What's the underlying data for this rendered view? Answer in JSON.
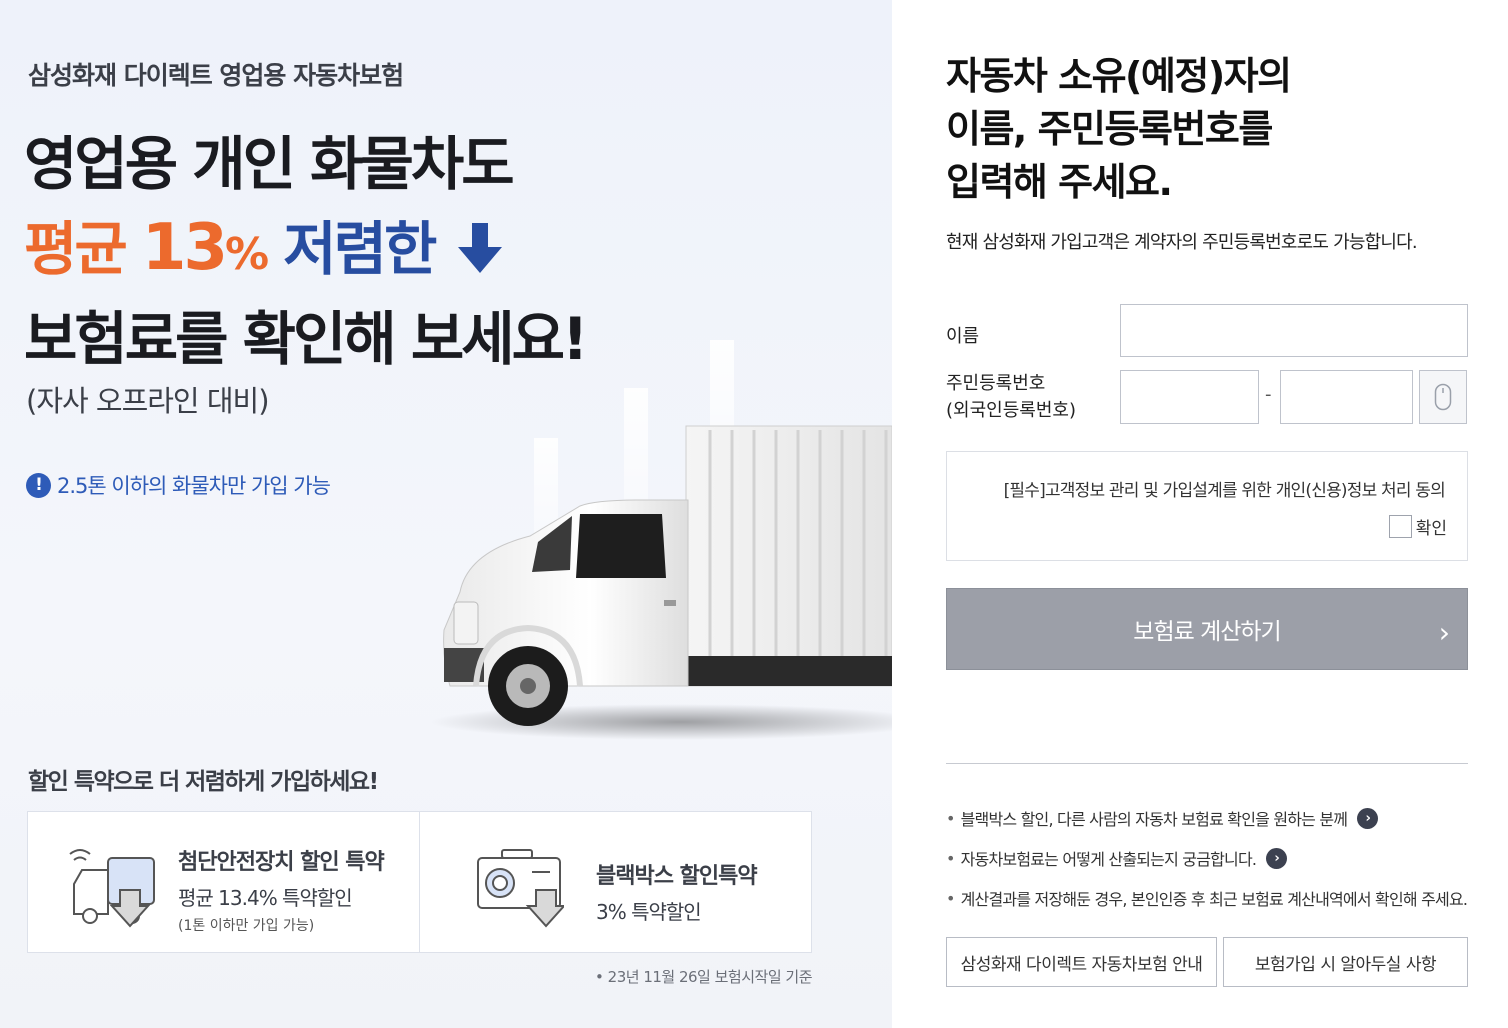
{
  "promo": {
    "brand": "삼성화재 다이렉트 영업용 자동차보험",
    "headline_line1": "영업용 개인 화물차도",
    "headline_avg": "평균 ",
    "headline_pct_number": "13",
    "headline_pct_sign": "%",
    "headline_cheaper": " 저렴한",
    "headline_line3": "보험료를 확인해 보세요!",
    "sub_note": "(자사 오프라인 대비)",
    "notice_icon": "!",
    "notice_text": "2.5톤 이하의 화물차만 가입 가능",
    "discount_title": "할인 특약으로 더 저렴하게 가입하세요!",
    "discounts": [
      {
        "icon": "truck-down-arrow-icon",
        "title": "첨단안전장치 할인 특약",
        "sub": "평균 13.4% 특약할인",
        "note": "(1톤 이하만 가입 가능)"
      },
      {
        "icon": "dashcam-down-arrow-icon",
        "title": "블랙박스 할인특약",
        "sub": "3% 특약할인",
        "note": ""
      }
    ],
    "footnote": "• 23년 11월 26일 보험시작일 기준"
  },
  "form": {
    "title": "자동차 소유(예정)자의\n이름, 주민등록번호를\n입력해 주세요.",
    "description": "현재 삼성화재 가입고객은 계약자의 주민등록번호로도 가능합니다.",
    "name_label": "이름",
    "name_value": "",
    "rrn_label_line1": "주민등록번호",
    "rrn_label_line2": "(외국인등록번호)",
    "rrn_front_value": "",
    "rrn_dash": "-",
    "rrn_back_value": "",
    "consent_text": "[필수]고객정보 관리 및 가입설계를 위한 개인(신용)정보 처리 동의",
    "consent_check_label": "확인",
    "consent_checked": false,
    "calc_button": "보험료 계산하기",
    "calc_chevron": "›"
  },
  "info": {
    "items": [
      {
        "text": "블랙박스 할인, 다른 사람의 자동차 보험료 확인을 원하는 분께",
        "has_arrow": true
      },
      {
        "text": "자동차보험료는 어떻게 산출되는지 궁금합니다.",
        "has_arrow": true
      },
      {
        "text": "계산결과를 저장해둔 경우, 본인인증 후 최근 보험료 계산내역에서 확인해 주세요.",
        "has_arrow": false
      }
    ],
    "bullet": "•",
    "arrow_glyph": "›",
    "button_guide": "삼성화재 다이렉트 자동차보험 안내",
    "button_notice": "보험가입 시 알아두실 사항"
  },
  "colors": {
    "accent_orange": "#ec6a2d",
    "accent_blue": "#274da0",
    "notice_blue": "#2e5bb8",
    "calc_button_gray": "#9c9fa8"
  }
}
